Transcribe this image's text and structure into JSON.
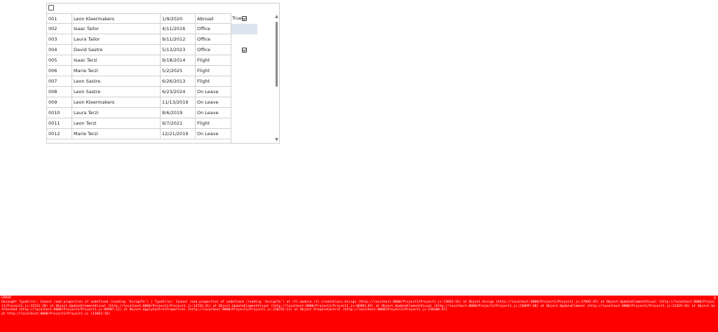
{
  "table": {
    "rows": [
      {
        "id": "001",
        "name": "Leon Kleermakers",
        "date": "1/9/2020",
        "status": "Abroad"
      },
      {
        "id": "002",
        "name": "Isaac Tailor",
        "date": "4/11/2016",
        "status": "Office"
      },
      {
        "id": "003",
        "name": "Laura Tailor",
        "date": "9/11/2012",
        "status": "Office"
      },
      {
        "id": "004",
        "name": "David Sastre",
        "date": "5/13/2023",
        "status": "Office"
      },
      {
        "id": "005",
        "name": "Isaac Terzi",
        "date": "9/18/2014",
        "status": "Flight"
      },
      {
        "id": "006",
        "name": "Marie Terzi",
        "date": "5/2/2025",
        "status": "Flight"
      },
      {
        "id": "007",
        "name": "Leon Sastre",
        "date": "6/26/2013",
        "status": "Flight"
      },
      {
        "id": "008",
        "name": "Leon Sastre",
        "date": "6/23/2024",
        "status": "On Leave"
      },
      {
        "id": "009",
        "name": "Leon Kleermakers",
        "date": "11/13/2019",
        "status": "On Leave"
      },
      {
        "id": "0010",
        "name": "Laura Terzi",
        "date": "8/6/2019",
        "status": "On Leave"
      },
      {
        "id": "0011",
        "name": "Leon Terzi",
        "date": "9/7/2021",
        "status": "Flight"
      },
      {
        "id": "0012",
        "name": "Marie Terzi",
        "date": "12/21/2019",
        "status": "On Leave"
      }
    ],
    "bool_first_text": "True"
  },
  "error": {
    "title": "ERROR",
    "message": "Uncaught TypeError: Cannot read properties of undefined (reading 'AssignTo') | TypeError: Cannot read properties of undefined (reading 'AssignTo') at rtl.module.rtl.createClass.Assign (http://localhost:8000/Project1/Project1.js:13663:16) at Object.Assign (http://localhost:8000/Project1/Project1.js:37092:45) at Object.UpdateElementVisual (http://localhost:8000/Project1/Project1.js:31531:28) at Object.UpdateElementVisual (http://localhost:8000/Project1/Project1.js:33743:41) at Object.UpdateElementVisual (http://localhost:8000/Project1/Project1.js:86903:65) at Object.UpdateElementVisual (http://localhost:8000/Project1/Project1.js:230697:40) at Object.UpdateElement (http://localhost:8000/Project1/Project1.js:31419:16) at Object.SetChecked (http://localhost:8000/Project1/Project1.js:86987:12) at Object.ApplyControlProperties (http://localhost:8000/Project1/Project1.js:230742:11) at Object.PrepareControl (http://localhost:8000/Project1/Project1.js:230100:47)\nat http://localhost:8000/Project1/Project1.js [13663:16]",
    "close_label": "X"
  }
}
